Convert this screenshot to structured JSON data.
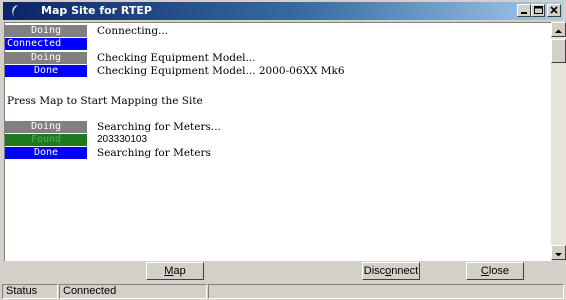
{
  "window": {
    "title": "Map Site for RTEP"
  },
  "log": {
    "entries": [
      {
        "status": "Doing",
        "message": "Connecting..."
      },
      {
        "status": "Connected",
        "message": ""
      },
      {
        "status": "Doing",
        "message": "Checking Equipment Model..."
      },
      {
        "status": "Done",
        "message": "Checking Equipment Model... 2000-06XX Mk6"
      },
      {
        "status": "",
        "message": "Press Map to Start Mapping the Site"
      },
      {
        "status": "Doing",
        "message": "Searching for Meters..."
      },
      {
        "status": "Found",
        "message": "203330103"
      },
      {
        "status": "Done",
        "message": "Searching for Meters"
      }
    ]
  },
  "buttons": {
    "map": {
      "before": "",
      "key": "M",
      "after": "ap"
    },
    "disconnect": {
      "before": "Disc",
      "key": "o",
      "after": "nnect"
    },
    "close": {
      "before": "",
      "key": "C",
      "after": "lose"
    }
  },
  "statusbar": {
    "label": "Status",
    "value": "Connected"
  },
  "colors": {
    "doing": "#808080",
    "done": "#0000ff",
    "connected": "#0000ff",
    "found": "#1f7a1f"
  }
}
